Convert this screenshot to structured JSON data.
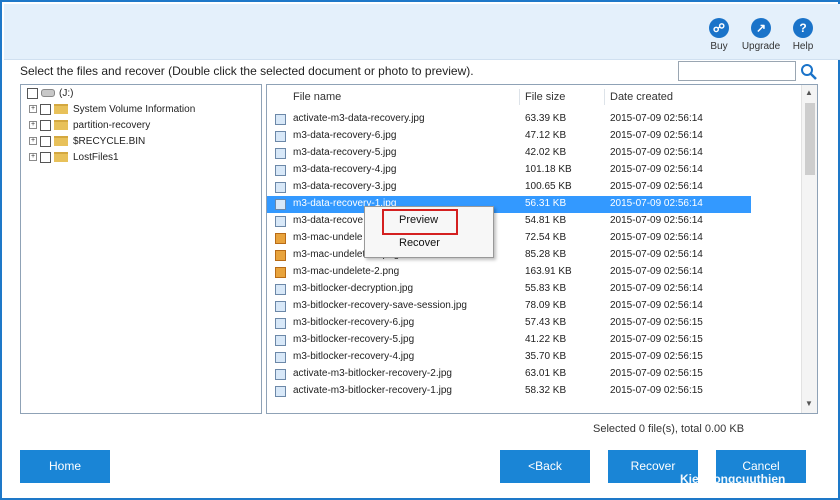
{
  "header": {
    "buttons": [
      {
        "label": "Buy",
        "icon": "cart-icon"
      },
      {
        "label": "Upgrade",
        "icon": "upgrade-icon"
      },
      {
        "label": "Help",
        "icon": "help-icon"
      }
    ]
  },
  "instruction": "Select the files and recover (Double click the selected document or photo to preview).",
  "search": {
    "value": "",
    "icon": "search-icon"
  },
  "tree": [
    {
      "label": "(J:)",
      "type": "drive"
    },
    {
      "label": "System Volume Information",
      "type": "folder"
    },
    {
      "label": "partition-recovery",
      "type": "folder"
    },
    {
      "label": "$RECYCLE.BIN",
      "type": "folder"
    },
    {
      "label": "LostFiles1",
      "type": "folder"
    }
  ],
  "list": {
    "columns": {
      "name": "File name",
      "size": "File size",
      "date": "Date created"
    },
    "rows": [
      {
        "name": "activate-m3-data-recovery.jpg",
        "size": "63.39 KB",
        "date": "2015-07-09 02:56:14",
        "kind": "img"
      },
      {
        "name": "m3-data-recovery-6.jpg",
        "size": "47.12 KB",
        "date": "2015-07-09 02:56:14",
        "kind": "img"
      },
      {
        "name": "m3-data-recovery-5.jpg",
        "size": "42.02 KB",
        "date": "2015-07-09 02:56:14",
        "kind": "img"
      },
      {
        "name": "m3-data-recovery-4.jpg",
        "size": "101.18 KB",
        "date": "2015-07-09 02:56:14",
        "kind": "img"
      },
      {
        "name": "m3-data-recovery-3.jpg",
        "size": "100.65 KB",
        "date": "2015-07-09 02:56:14",
        "kind": "img"
      },
      {
        "name": "m3-data-recovery-1.jpg",
        "size": "56.31 KB",
        "date": "2015-07-09 02:56:14",
        "kind": "img",
        "selected": true
      },
      {
        "name": "m3-data-recove",
        "size": "54.81 KB",
        "date": "2015-07-09 02:56:14",
        "kind": "img"
      },
      {
        "name": "m3-mac-undele",
        "size": "72.54 KB",
        "date": "2015-07-09 02:56:14",
        "kind": "mac"
      },
      {
        "name": "m3-mac-undelete-1.png",
        "size": "85.28 KB",
        "date": "2015-07-09 02:56:14",
        "kind": "mac"
      },
      {
        "name": "m3-mac-undelete-2.png",
        "size": "163.91 KB",
        "date": "2015-07-09 02:56:14",
        "kind": "mac"
      },
      {
        "name": "m3-bitlocker-decryption.jpg",
        "size": "55.83 KB",
        "date": "2015-07-09 02:56:14",
        "kind": "img"
      },
      {
        "name": "m3-bitlocker-recovery-save-session.jpg",
        "size": "78.09 KB",
        "date": "2015-07-09 02:56:14",
        "kind": "img"
      },
      {
        "name": "m3-bitlocker-recovery-6.jpg",
        "size": "57.43 KB",
        "date": "2015-07-09 02:56:15",
        "kind": "img"
      },
      {
        "name": "m3-bitlocker-recovery-5.jpg",
        "size": "41.22 KB",
        "date": "2015-07-09 02:56:15",
        "kind": "img"
      },
      {
        "name": "m3-bitlocker-recovery-4.jpg",
        "size": "35.70 KB",
        "date": "2015-07-09 02:56:15",
        "kind": "img"
      },
      {
        "name": "activate-m3-bitlocker-recovery-2.jpg",
        "size": "63.01 KB",
        "date": "2015-07-09 02:56:15",
        "kind": "img"
      },
      {
        "name": "activate-m3-bitlocker-recovery-1.jpg",
        "size": "58.32 KB",
        "date": "2015-07-09 02:56:15",
        "kind": "img"
      }
    ]
  },
  "context_menu": {
    "preview": "Preview",
    "recover": "Recover"
  },
  "status": "Selected 0 file(s), total 0.00 KB",
  "buttons": {
    "home": "Home",
    "back": "<Back",
    "recover": "Recover",
    "cancel": "Cancel"
  },
  "watermark": "Kiendongcuuthien",
  "colors": {
    "accent": "#1a85d6",
    "selection": "#3399ff",
    "highlight": "#d42020"
  }
}
